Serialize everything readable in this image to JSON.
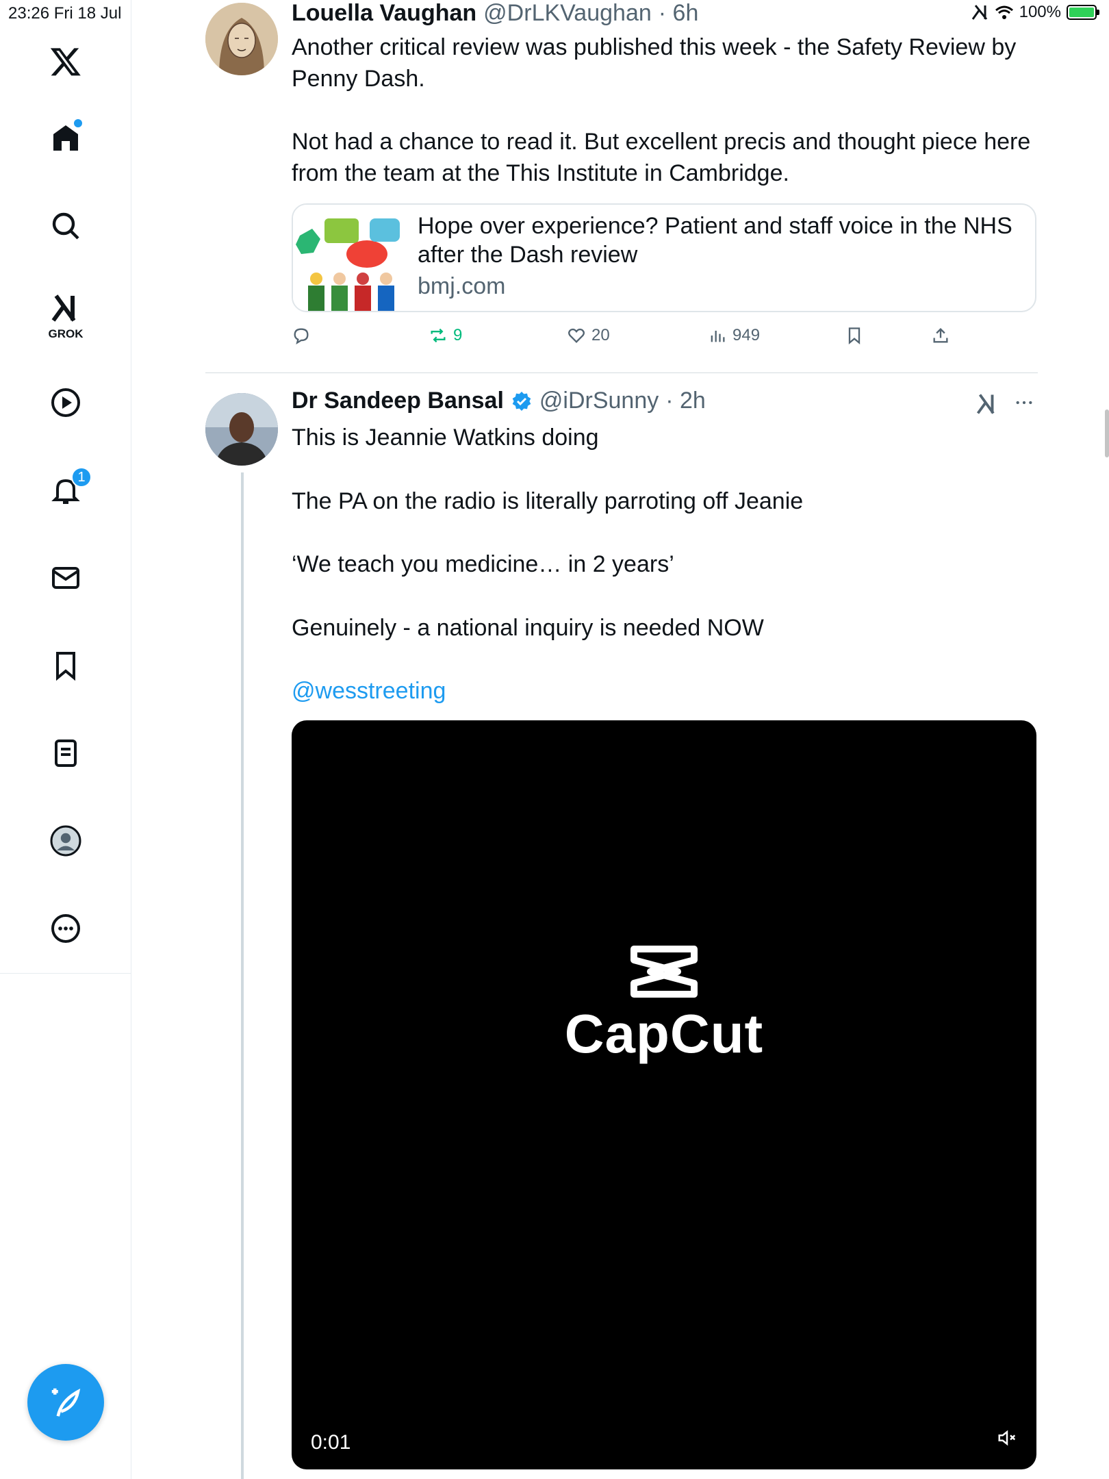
{
  "status_bar": {
    "time_date": "23:26   Fri 18 Jul",
    "battery": "100%",
    "battery_level": 1.0
  },
  "sidebar": {
    "grok_label": "GROK",
    "notifications_badge": "1"
  },
  "tweets": [
    {
      "name": "Louella Vaughan",
      "handle": "@DrLKVaughan",
      "time": "· 6h",
      "text": "Another critical review was published this week - the Safety Review by Penny Dash.\n\nNot had a chance to read it. But excellent precis and thought piece here from the team at the This Institute in Cambridge.",
      "card": {
        "title": "Hope over experience? Patient and staff voice in the NHS after the Dash review",
        "domain": "bmj.com"
      },
      "actions": {
        "reposts": "9",
        "likes": "20",
        "views": "949"
      }
    },
    {
      "name": "Dr Sandeep Bansal",
      "handle": "@iDrSunny",
      "time": "· 2h",
      "text_lines": [
        "This is Jeannie Watkins doing",
        "The PA on the radio is literally parroting off Jeanie",
        "‘We teach you medicine… in 2 years’",
        "Genuinely - a national inquiry is needed NOW"
      ],
      "mention": "@wesstreeting",
      "video": {
        "brand": "CapCut",
        "time": "0:01"
      }
    }
  ]
}
